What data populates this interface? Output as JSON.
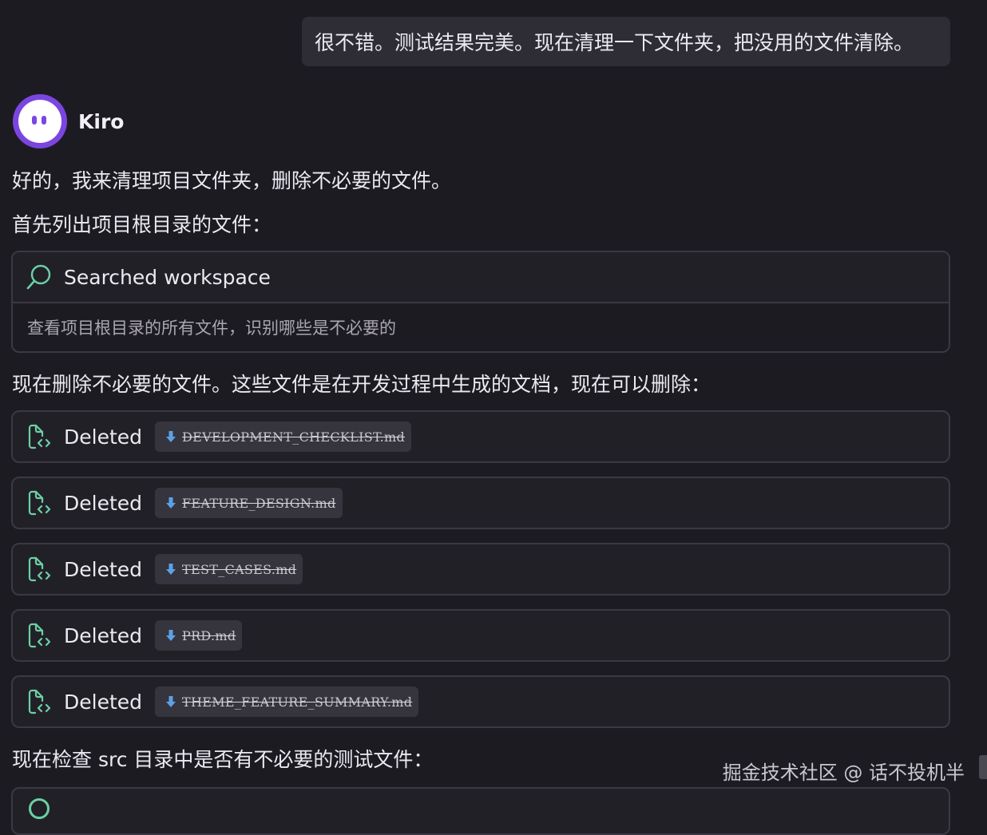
{
  "user_message": {
    "text": "很不错。测试结果完美。现在清理一下文件夹，把没用的文件清除。"
  },
  "agent": {
    "name": "Kiro",
    "avatar_color": "#7b45e0"
  },
  "paragraphs": {
    "intro": "好的，我来清理项目文件夹，删除不必要的文件。",
    "list_root": "首先列出项目根目录的文件：",
    "delete_docs": "现在删除不必要的文件。这些文件是在开发过程中生成的文档，现在可以删除：",
    "check_src": "现在检查 src 目录中是否有不必要的测试文件："
  },
  "search_tool": {
    "icon": "search-icon",
    "label": "Searched workspace",
    "description": "查看项目根目录的所有文件，识别哪些是不必要的"
  },
  "deletions": [
    {
      "status": "Deleted",
      "file": "DEVELOPMENT_CHECKLIST.md"
    },
    {
      "status": "Deleted",
      "file": "FEATURE_DESIGN.md"
    },
    {
      "status": "Deleted",
      "file": "TEST_CASES.md"
    },
    {
      "status": "Deleted",
      "file": "PRD.md"
    },
    {
      "status": "Deleted",
      "file": "THEME_FEATURE_SUMMARY.md"
    }
  ],
  "watermark": "掘金技术社区 @ 话不投机半",
  "colors": {
    "background": "#1d1b22",
    "card_border": "#3a3842",
    "accent_green": "#6bd0a4",
    "file_icon_blue": "#5aa2e6"
  }
}
